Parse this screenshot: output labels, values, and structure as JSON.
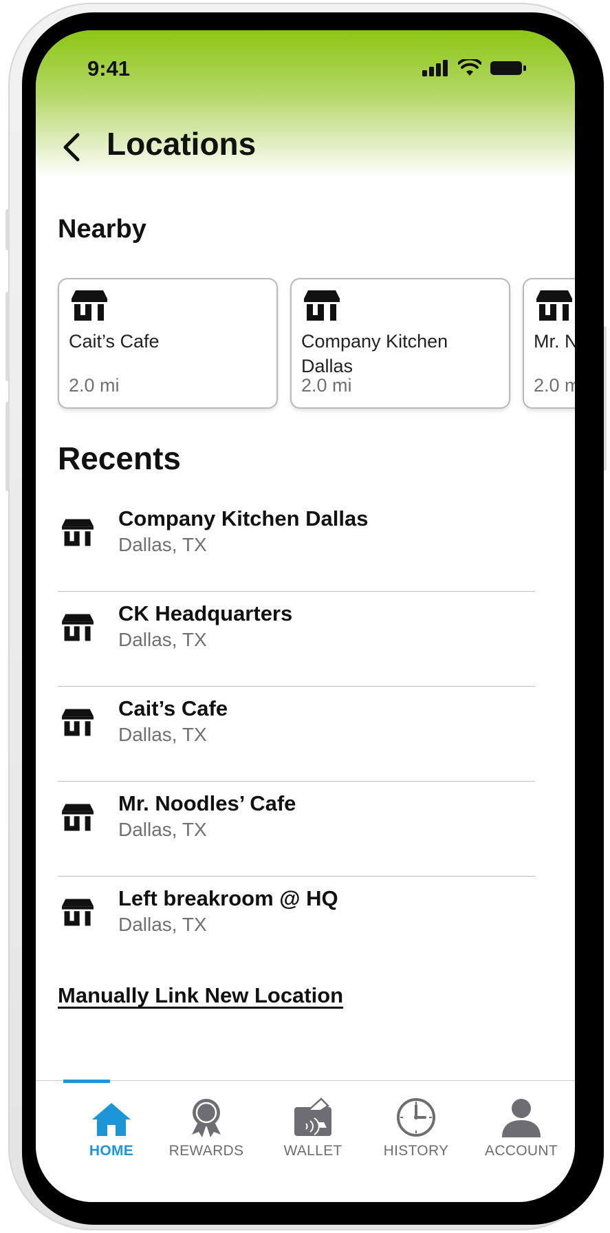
{
  "status_bar": {
    "time": "9:41"
  },
  "header": {
    "title": "Locations"
  },
  "nearby": {
    "heading": "Nearby",
    "cards": [
      {
        "name": "Cait’s Cafe",
        "distance": "2.0 mi"
      },
      {
        "name": "Company Kitchen Dallas",
        "distance": "2.0 mi"
      },
      {
        "name": "Mr. N",
        "distance": "2.0 m"
      }
    ]
  },
  "recents": {
    "heading": "Recents",
    "items": [
      {
        "name": "Company Kitchen Dallas",
        "location": "Dallas, TX"
      },
      {
        "name": "CK Headquarters",
        "location": "Dallas, TX"
      },
      {
        "name": "Cait’s Cafe",
        "location": "Dallas, TX"
      },
      {
        "name": "Mr. Noodles’ Cafe",
        "location": "Dallas, TX"
      },
      {
        "name": "Left breakroom @ HQ",
        "location": "Dallas, TX"
      }
    ]
  },
  "manual_link": "Manually Link New Location",
  "tabbar": {
    "accent": "#1c96d6",
    "tabs": [
      {
        "label": "HOME",
        "icon": "home-icon",
        "active": true
      },
      {
        "label": "REWARDS",
        "icon": "rewards-icon",
        "active": false
      },
      {
        "label": "WALLET",
        "icon": "wallet-icon",
        "active": false
      },
      {
        "label": "HISTORY",
        "icon": "history-icon",
        "active": false
      },
      {
        "label": "ACCOUNT",
        "icon": "account-icon",
        "active": false
      }
    ]
  },
  "colors": {
    "header_green": "#8cc614",
    "text": "#111111",
    "muted": "#707070"
  }
}
